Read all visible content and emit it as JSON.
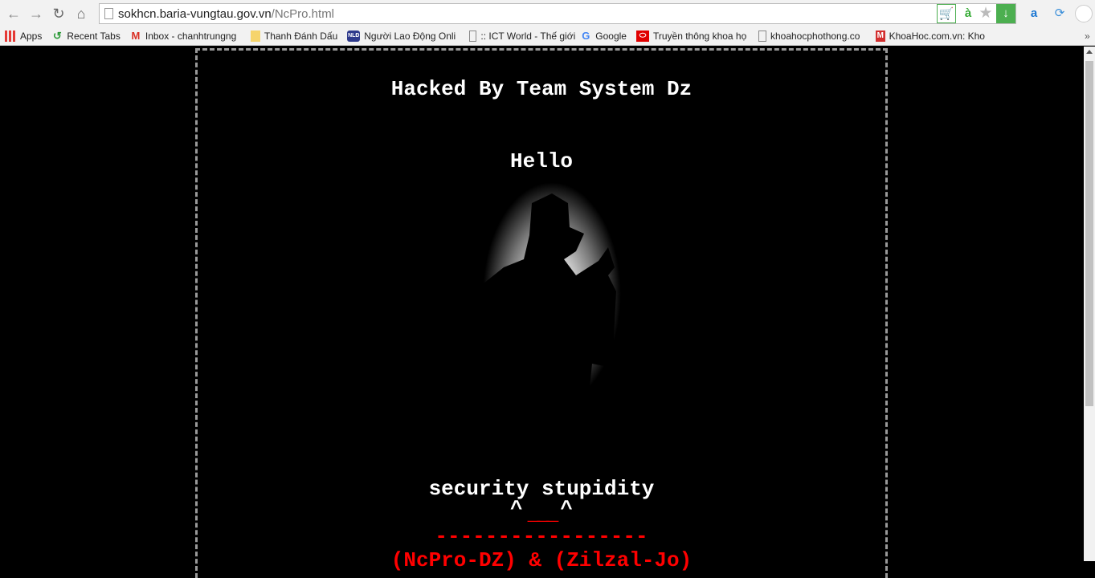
{
  "browser": {
    "url_host": "sokhcn.baria-vungtau.gov.vn",
    "url_path": "/NcPro.html",
    "bookmarks": [
      {
        "label": "Apps",
        "icon": "apps-grid-icon",
        "color": "#e53935"
      },
      {
        "label": "Recent Tabs",
        "icon": "history-icon",
        "color": "#2e9b3a"
      },
      {
        "label": "Inbox - chanhtrungng",
        "icon": "gmail-icon",
        "color": "#d93025"
      },
      {
        "label": "Thanh Đánh Dấu",
        "icon": "folder-icon",
        "color": "#f6d46b"
      },
      {
        "label": "Người Lao Động Onli",
        "icon": "nld-icon",
        "color": "#2e3a8c"
      },
      {
        "label": ":: ICT World - Thế giới",
        "icon": "page-icon",
        "color": "#ffffff"
      },
      {
        "label": "Google",
        "icon": "google-icon",
        "color": "#4285f4"
      },
      {
        "label": "Truyền thông khoa họ",
        "icon": "oracle-icon",
        "color": "#e00000"
      },
      {
        "label": "khoahocphothong.co",
        "icon": "page-icon",
        "color": "#ffffff"
      },
      {
        "label": "KhoaHoc.com.vn: Kho",
        "icon": "m-icon",
        "color": "#d32f2f"
      }
    ],
    "overflow": "»"
  },
  "page": {
    "title": "Hacked By Team System Dz",
    "greeting": "Hello",
    "tagline": "security stupidity",
    "face_eyes": "^   ^",
    "face_mouth": "___",
    "divider": "-----------------",
    "credits": "(NcPro-DZ) & (Zilzal-Jo)",
    "text_color": "#ffffff",
    "accent_color": "#ff0000"
  }
}
